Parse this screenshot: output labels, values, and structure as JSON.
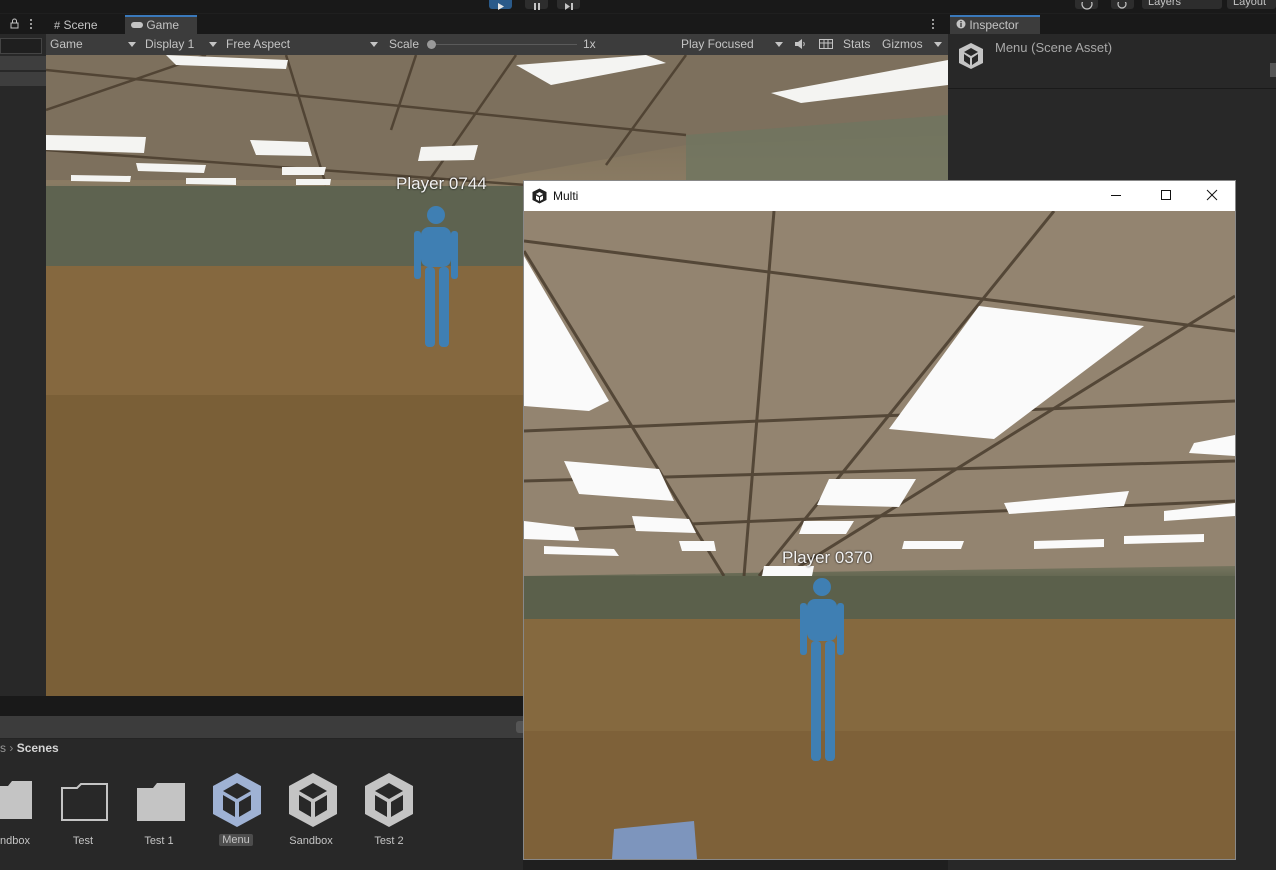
{
  "toolbar": {
    "layers_label": "Layers",
    "layout_label": "Layout"
  },
  "tabs": {
    "scene": "Scene",
    "game": "Game",
    "inspector": "Inspector"
  },
  "game_bar": {
    "mode": "Game",
    "display": "Display 1",
    "aspect": "Free Aspect",
    "scale_label": "Scale",
    "scale_value": "1x",
    "play_mode": "Play Focused",
    "stats": "Stats",
    "gizmos": "Gizmos"
  },
  "game_view": {
    "player_label": "Player 0744"
  },
  "inspector": {
    "title": "Menu (Scene Asset)"
  },
  "multi_window": {
    "title": "Multi",
    "player_label": "Player 0370"
  },
  "project": {
    "breadcrumb_prev": "s",
    "breadcrumb_current": "Scenes",
    "assets": [
      {
        "label": "ndbox",
        "type": "folder"
      },
      {
        "label": "Test",
        "type": "folder-open"
      },
      {
        "label": "Test 1",
        "type": "folder"
      },
      {
        "label": "Menu",
        "type": "unity-scene",
        "selected": true
      },
      {
        "label": "Sandbox",
        "type": "unity-scene"
      },
      {
        "label": "Test 2",
        "type": "unity-scene"
      }
    ]
  }
}
